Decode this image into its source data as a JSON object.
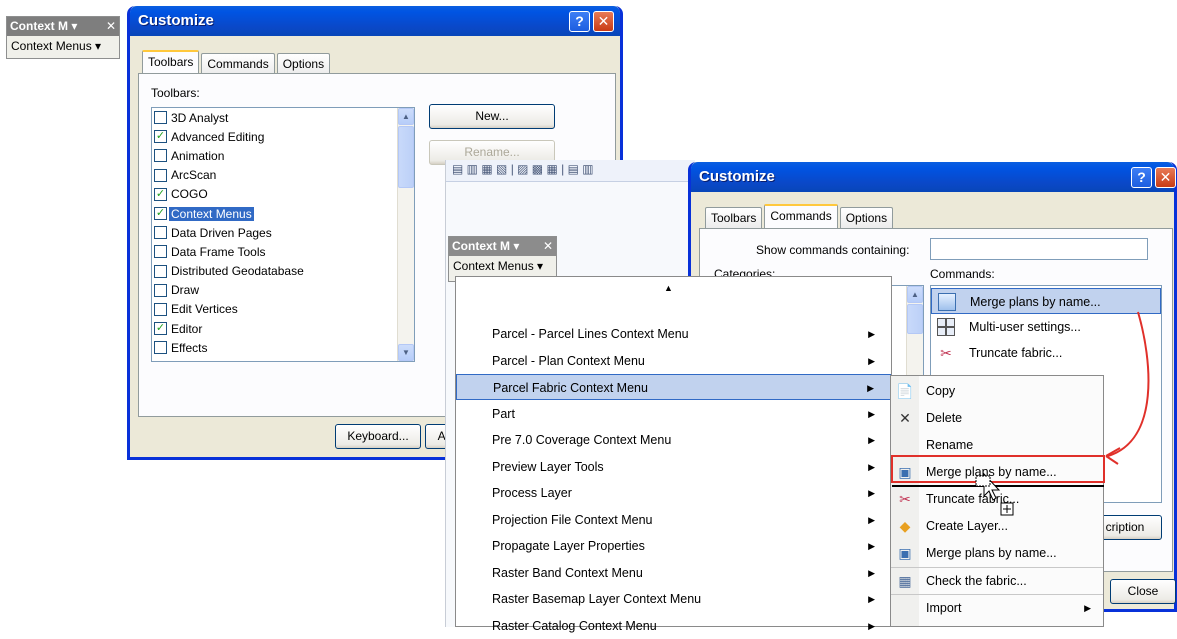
{
  "small_toolbar": {
    "title": "Context M",
    "dropdown_label": "Context Menus"
  },
  "dialog1": {
    "title": "Customize",
    "tabs": [
      "Toolbars",
      "Commands",
      "Options"
    ],
    "toolbars_label": "Toolbars:",
    "toolbars": [
      {
        "label": "3D Analyst",
        "checked": false
      },
      {
        "label": "Advanced Editing",
        "checked": true
      },
      {
        "label": "Animation",
        "checked": false
      },
      {
        "label": "ArcScan",
        "checked": false
      },
      {
        "label": "COGO",
        "checked": true
      },
      {
        "label": "Context Menus",
        "checked": true,
        "selected": true
      },
      {
        "label": "Data Driven Pages",
        "checked": false
      },
      {
        "label": "Data Frame Tools",
        "checked": false
      },
      {
        "label": "Distributed Geodatabase",
        "checked": false
      },
      {
        "label": "Draw",
        "checked": false
      },
      {
        "label": "Edit Vertices",
        "checked": false
      },
      {
        "label": "Editor",
        "checked": true
      },
      {
        "label": "Effects",
        "checked": false
      }
    ],
    "buttons": {
      "new": "New...",
      "rename": "Rename...",
      "keyboard": "Keyboard...",
      "add": "Ad"
    }
  },
  "middle_toolbar": {
    "title": "Context M",
    "dropdown_label": "Context Menus"
  },
  "context_menu": {
    "items": [
      {
        "label": "Parcel - Parcel Lines Context Menu"
      },
      {
        "label": "Parcel - Plan Context Menu"
      },
      {
        "label": "Parcel Fabric Context Menu",
        "highlight": true
      },
      {
        "label": "Part"
      },
      {
        "label": "Pre 7.0 Coverage Context Menu"
      },
      {
        "label": "Preview Layer Tools"
      },
      {
        "label": "Process Layer"
      },
      {
        "label": "Projection File Context Menu"
      },
      {
        "label": "Propagate Layer Properties"
      },
      {
        "label": "Raster Band Context Menu"
      },
      {
        "label": "Raster Basemap Layer Context Menu"
      },
      {
        "label": "Raster Catalog Context Menu"
      }
    ]
  },
  "submenu": {
    "items": [
      {
        "label": "Copy",
        "icon": "copy-icon"
      },
      {
        "label": "Delete",
        "icon": "delete-icon"
      },
      {
        "label": "Rename",
        "icon": ""
      },
      {
        "label": "Merge plans by name...",
        "icon": "merge-icon"
      },
      {
        "label": "Truncate fabric...",
        "icon": "truncate-icon"
      },
      {
        "label": "Create Layer...",
        "icon": "diamond-icon"
      },
      {
        "label": "Merge plans by name...",
        "icon": "merge-icon"
      },
      {
        "label": "Check the fabric...",
        "icon": "check-icon"
      },
      {
        "label": "Import",
        "icon": ""
      }
    ]
  },
  "dialog2": {
    "title": "Customize",
    "tabs": [
      "Toolbars",
      "Commands",
      "Options"
    ],
    "show_commands_label": "Show commands containing:",
    "show_commands_value": "",
    "categories_label": "Categories:",
    "commands_label": "Commands:",
    "commands": [
      "Merge plans by name...",
      "Multi-user settings...",
      "Truncate fabric..."
    ],
    "description_button": "cription",
    "close_button": "Close"
  },
  "colors": {
    "xp_blue": "#0054e3",
    "highlight": "#c1d2ee",
    "annotation_red": "#e0302a"
  }
}
